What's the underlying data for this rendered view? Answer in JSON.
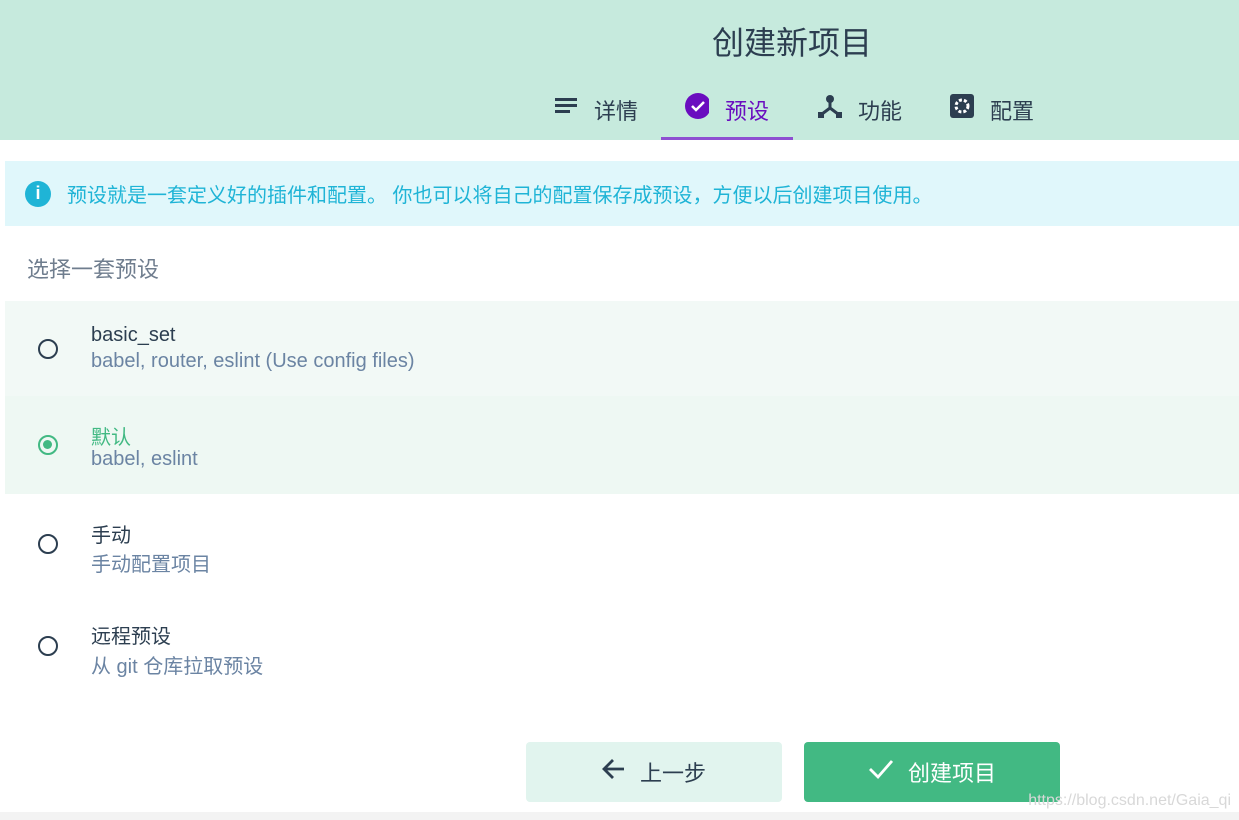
{
  "header": {
    "title": "创建新项目",
    "tabs": [
      {
        "label": "详情",
        "icon": "list-icon"
      },
      {
        "label": "预设",
        "icon": "check-circle-icon",
        "active": true
      },
      {
        "label": "功能",
        "icon": "fork-icon"
      },
      {
        "label": "配置",
        "icon": "gear-icon"
      }
    ]
  },
  "info": {
    "text": "预设就是一套定义好的插件和配置。 你也可以将自己的配置保存成预设，方便以后创建项目使用。"
  },
  "section_title": "选择一套预设",
  "presets": [
    {
      "name": "basic_set",
      "desc": "babel, router, eslint (Use config files)",
      "selected": false
    },
    {
      "name": "默认",
      "desc": "babel, eslint",
      "selected": true
    },
    {
      "name": "手动",
      "desc": "手动配置项目",
      "selected": false
    },
    {
      "name": "远程预设",
      "desc": "从 git 仓库拉取预设",
      "selected": false
    }
  ],
  "buttons": {
    "back": "上一步",
    "create": "创建项目"
  },
  "watermark": "https://blog.csdn.net/Gaia_qi",
  "colors": {
    "accent": "#42b983",
    "tab_active": "#6a0dbf",
    "info": "#1fb4d6"
  }
}
